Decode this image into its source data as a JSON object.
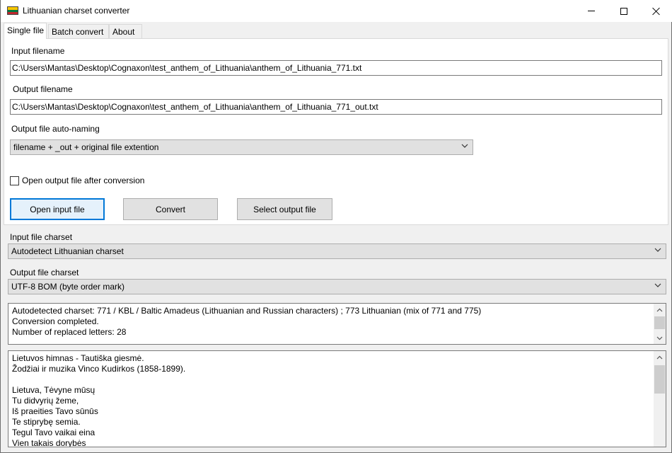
{
  "window": {
    "title": "Lithuanian charset converter",
    "flag_colors": [
      "#f7c600",
      "#00783f",
      "#c1272d"
    ]
  },
  "tabs": [
    {
      "label": "Single file",
      "active": true
    },
    {
      "label": "Batch convert",
      "active": false
    },
    {
      "label": "About",
      "active": false
    }
  ],
  "single_file": {
    "input_label": "Input filename",
    "input_value": "C:\\Users\\Mantas\\Desktop\\Cognaxon\\test_anthem_of_Lithuania\\anthem_of_Lithuania_771.txt",
    "output_label": "Output filename",
    "output_value": "C:\\Users\\Mantas\\Desktop\\Cognaxon\\test_anthem_of_Lithuania\\anthem_of_Lithuania_771_out.txt",
    "autonaming_label": "Output file auto-naming",
    "autonaming_value": "filename + _out + original file extention",
    "open_after_label": "Open output file after conversion",
    "open_after_checked": false,
    "buttons": {
      "open_input": "Open input file",
      "convert": "Convert",
      "select_output": "Select output file"
    }
  },
  "charsets": {
    "input_label": "Input file charset",
    "input_value": "Autodetect Lithuanian charset",
    "output_label": "Output file charset",
    "output_value": "UTF-8 BOM (byte order mark)"
  },
  "log_lines": [
    "Autodetected charset: 771 / KBL / Baltic Amadeus (Lithuanian and Russian characters) ; 773 Lithuanian (mix of 771 and 775)",
    "Conversion completed.",
    "Number of replaced letters: 28"
  ],
  "preview_lines": [
    "Lietuvos himnas - Tautiška giesmė.",
    "Žodžiai ir muzika Vinco Kudirkos (1858-1899).",
    "",
    "Lietuva, Tėvyne mūsų",
    "Tu didvyrių žeme,",
    "Iš praeities Tavo sūnūs",
    "Te stiprybę semia.",
    "Tegul Tavo vaikai eina",
    "Vien takais dorybės"
  ]
}
